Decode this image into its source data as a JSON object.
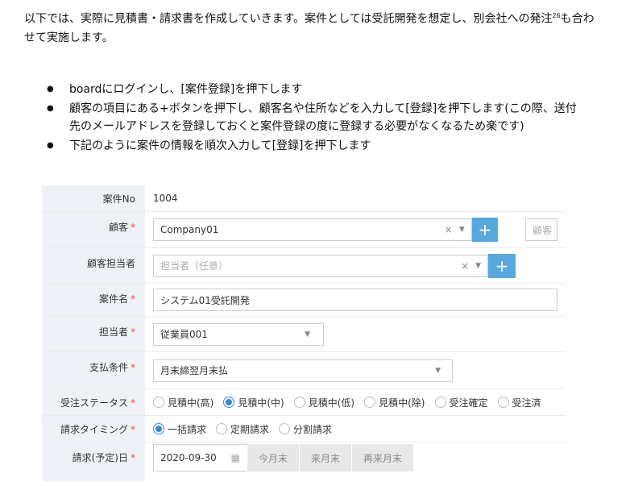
{
  "intro": {
    "text": "以下では、実際に見積書・請求書を作成していきます。案件としては受託開発を想定し、別会社への発注",
    "footnote": "26",
    "text_end": "も合わせて実施します。"
  },
  "bullets": [
    "boardにログインし、[案件登録]を押下します",
    "顧客の項目にある+ボタンを押下し、顧客名や住所などを入力して[登録]を押下します(この際、送付先のメールアドレスを登録しておくと案件登録の度に登録する必要がなくなるため楽です)",
    "下記のように案件の情報を順次入力して[登録]を押下します"
  ],
  "form": {
    "case_no": {
      "label": "案件No",
      "value": "1004"
    },
    "customer": {
      "label": "顧客",
      "required": "*",
      "value": "Company01",
      "clear": "×",
      "extra_placeholder": "顧客"
    },
    "contact": {
      "label": "顧客担当者",
      "placeholder": "担当者（任意）",
      "clear": "×"
    },
    "case_name": {
      "label": "案件名",
      "required": "*",
      "value": "システム01受託開発"
    },
    "owner": {
      "label": "担当者",
      "required": "*",
      "value": "従業員001"
    },
    "payment": {
      "label": "支払条件",
      "required": "*",
      "value": "月末締翌月末払"
    },
    "status": {
      "label": "受注ステータス",
      "required": "*",
      "options": [
        "見積中(高)",
        "見積中(中)",
        "見積中(低)",
        "見積中(除)",
        "受注確定",
        "受注済"
      ],
      "selected": "見積中(中)"
    },
    "billing_timing": {
      "label": "請求タイミング",
      "required": "*",
      "options": [
        "一括請求",
        "定期請求",
        "分割請求"
      ],
      "selected": "一括請求"
    },
    "billing_date": {
      "label": "請求(予定)日",
      "required": "*",
      "value": "2020-09-30",
      "buttons": [
        "今月末",
        "来月末",
        "再来月末"
      ]
    },
    "plus": "+",
    "accent": "#58a8de"
  }
}
